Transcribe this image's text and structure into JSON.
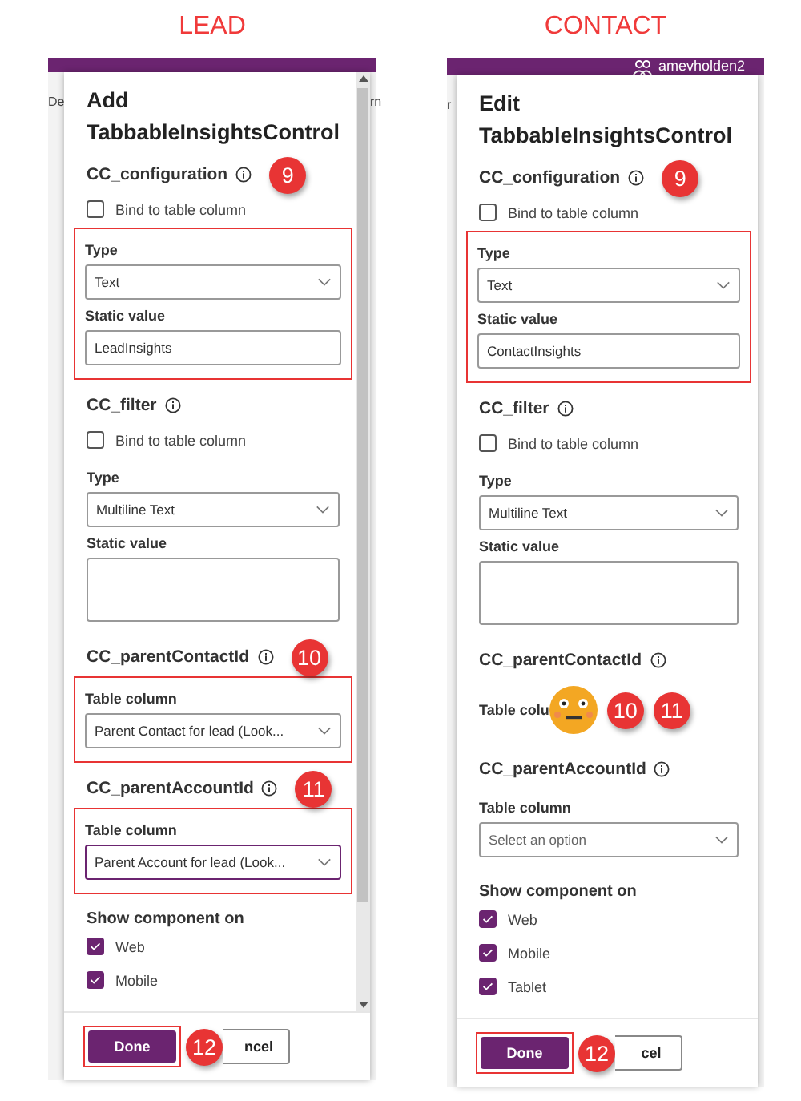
{
  "panels": [
    {
      "caption": "LEAD",
      "backdrop_texts": [
        "De",
        "rn"
      ],
      "heading": "Add",
      "title": "TabbableInsightsControl",
      "scrollbar": true,
      "sections": [
        {
          "name": "CC_configuration",
          "badges": [
            "9"
          ],
          "bind": {
            "label": "Bind to table column",
            "checked": false
          },
          "highlighted": true,
          "fields": [
            {
              "kind": "select",
              "label": "Type",
              "value": "Text"
            },
            {
              "kind": "input",
              "label": "Static value",
              "value": "LeadInsights"
            }
          ]
        },
        {
          "name": "CC_filter",
          "bind": {
            "label": "Bind to table column",
            "checked": false
          },
          "fields": [
            {
              "kind": "select",
              "label": "Type",
              "value": "Multiline Text"
            },
            {
              "kind": "textarea",
              "label": "Static value"
            }
          ]
        },
        {
          "name": "CC_parentContactId",
          "badges": [
            "10"
          ],
          "highlighted": true,
          "fields": [
            {
              "kind": "select",
              "label": "Table column",
              "value": "Parent Contact for lead (Look..."
            }
          ]
        },
        {
          "name": "CC_parentAccountId",
          "badges": [
            "11"
          ],
          "highlighted": true,
          "fields": [
            {
              "kind": "select",
              "label": "Table column",
              "value": "Parent Account for lead (Look...",
              "focused": true
            }
          ]
        }
      ],
      "show_on": {
        "title": "Show component on",
        "options": [
          {
            "label": "Web",
            "checked": true
          },
          {
            "label": "Mobile",
            "checked": true
          }
        ]
      },
      "done": {
        "label": "Done",
        "highlighted": true,
        "badge": "12"
      },
      "cancel": {
        "label": "ncel"
      }
    },
    {
      "caption": "CONTACT",
      "backdrop_texts": [
        "r"
      ],
      "user": "amevholden2",
      "heading": "Edit",
      "title": "TabbableInsightsControl",
      "sections": [
        {
          "name": "CC_configuration",
          "badges": [
            "9"
          ],
          "bind": {
            "label": "Bind to table column",
            "checked": false
          },
          "highlighted": true,
          "fields": [
            {
              "kind": "select",
              "label": "Type",
              "value": "Text"
            },
            {
              "kind": "input",
              "label": "Static value",
              "value": "ContactInsights"
            }
          ]
        },
        {
          "name": "CC_filter",
          "bind": {
            "label": "Bind to table column",
            "checked": false
          },
          "fields": [
            {
              "kind": "select",
              "label": "Type",
              "value": "Multiline Text"
            },
            {
              "kind": "textarea",
              "label": "Static value"
            }
          ]
        },
        {
          "name": "CC_parentContactId",
          "fields": [
            {
              "kind": "obscured",
              "label": "Table colu",
              "badges": [
                "10",
                "11"
              ]
            }
          ]
        },
        {
          "name": "CC_parentAccountId",
          "fields": [
            {
              "kind": "select",
              "label": "Table column",
              "placeholder": "Select an option"
            }
          ]
        }
      ],
      "show_on": {
        "title": "Show component on",
        "options": [
          {
            "label": "Web",
            "checked": true
          },
          {
            "label": "Mobile",
            "checked": true
          },
          {
            "label": "Tablet",
            "checked": true
          }
        ]
      },
      "done": {
        "label": "Done",
        "highlighted": true,
        "badge": "12"
      },
      "cancel": {
        "label": "cel"
      }
    }
  ]
}
